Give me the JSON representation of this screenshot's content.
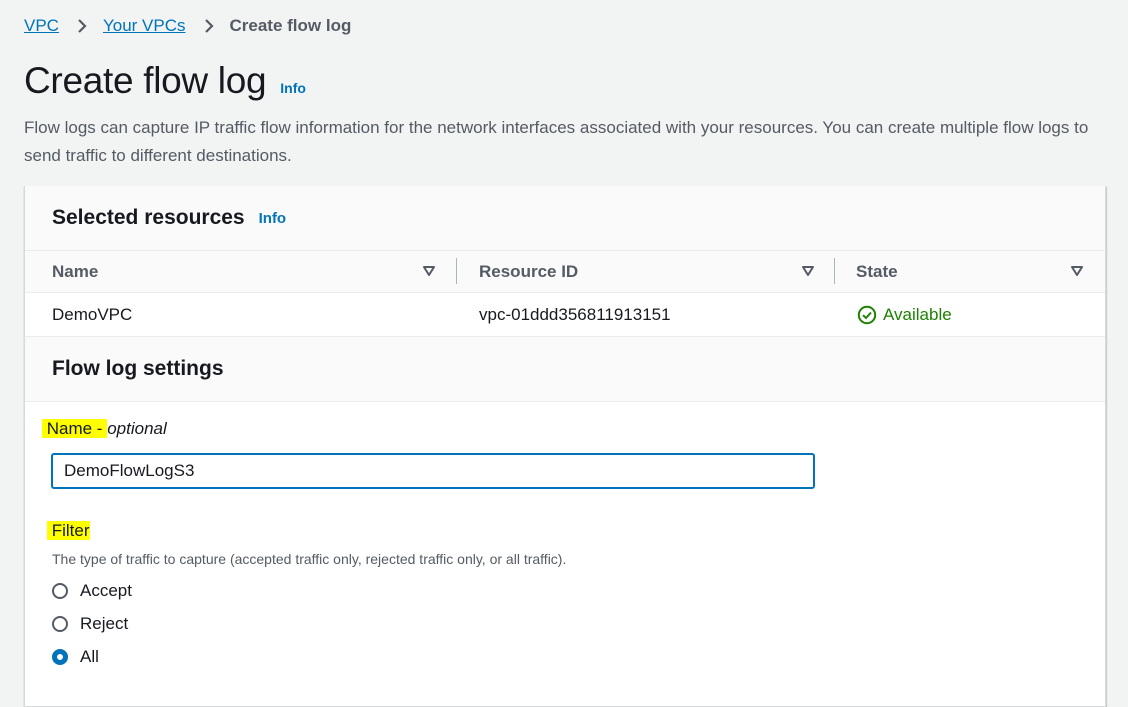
{
  "breadcrumb": {
    "items": [
      "VPC",
      "Your VPCs"
    ],
    "current": "Create flow log"
  },
  "page": {
    "title": "Create flow log",
    "info": "Info",
    "description": "Flow logs can capture IP traffic flow information for the network interfaces associated with your resources. You can create multiple flow logs to send traffic to different destinations."
  },
  "selected_resources": {
    "title": "Selected resources",
    "info": "Info",
    "columns": [
      "Name",
      "Resource ID",
      "State"
    ],
    "rows": [
      {
        "name": "DemoVPC",
        "resource_id": "vpc-01ddd356811913151",
        "state": "Available"
      }
    ]
  },
  "settings": {
    "title": "Flow log settings",
    "name_label": "Name -",
    "name_optional": "optional",
    "name_value": "DemoFlowLogS3",
    "filter_label_highlight": "Filter",
    "filter_hint": "The type of traffic to capture (accepted traffic only, rejected traffic only, or all traffic).",
    "filter_options": [
      "Accept",
      "Reject",
      "All"
    ],
    "filter_selected": "All"
  },
  "colors": {
    "link": "#0073bb",
    "success": "#1d8102",
    "highlight": "#ffff00"
  }
}
